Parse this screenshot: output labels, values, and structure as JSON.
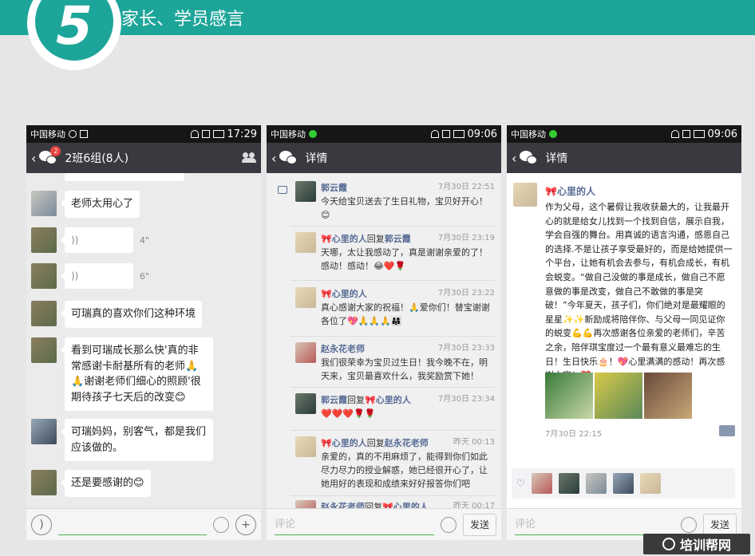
{
  "header": {
    "number": "5",
    "title": "家长、学员感言"
  },
  "phone1": {
    "status": {
      "carrier": "中国移动",
      "time": "17:29"
    },
    "title": "2班6组(8人)",
    "unread": "2",
    "messages": [
      {
        "text": "老师太用心了"
      },
      {
        "duration": "4\""
      },
      {
        "duration": "6\""
      },
      {
        "text": "可瑞真的喜欢你们这种环境"
      },
      {
        "text": "看到可瑞成长那么快'真的非常感谢卡耐基所有的老师🙏🙏谢谢老师们细心的照顾'很期待孩子七天后的改变😊"
      },
      {
        "text": "可瑞妈妈，别客气，都是我们应该做的。"
      },
      {
        "text": "还是要感谢的😊"
      }
    ]
  },
  "phone2": {
    "status": {
      "carrier": "中国移动",
      "time": "09:06"
    },
    "title": "详情",
    "comments": [
      {
        "name": "郭云霞",
        "reply_to": "",
        "time": "7月30日 22:51",
        "text": "今天给宝贝送去了生日礼物，宝贝好开心！😊"
      },
      {
        "name": "🎀心里的人",
        "reply_word": "回复",
        "reply_to": "郭云霞",
        "time": "7月30日 23:19",
        "text": "天哪，太让我感动了，真是谢谢亲爱的了！感动！感动！😂❤️🌹"
      },
      {
        "name": "🎀心里的人",
        "reply_to": "",
        "time": "7月30日 23:22",
        "text": "真心感谢大家的祝福！🙏爱你们！替宝谢谢各位了💖🙏🙏🙏👨‍👩‍👧"
      },
      {
        "name": "赵永花老师",
        "reply_to": "",
        "time": "7月30日 23:33",
        "text": "我们很荣幸为宝贝过生日！我今晚不在，明天来，宝贝最喜欢什么，我奖励赏下她！"
      },
      {
        "name": "郭云霞",
        "reply_word": "回复",
        "reply_to": "🎀心里的人",
        "time": "7月30日 23:34",
        "text": "❤️❤️❤️🌹🌹"
      },
      {
        "name": "🎀心里的人",
        "reply_word": "回复",
        "reply_to": "赵永花老师",
        "time": "昨天 00:13",
        "text": "亲爱的，真的不用麻烦了，能得到你们如此尽力尽力的授业解惑，她已经很开心了，让她用好的表现和成绩来好好报答你们吧"
      },
      {
        "name": "赵永花老师",
        "reply_word": "回复",
        "reply_to": "🎀心里的人",
        "time": "昨天 00:17",
        "text": ""
      }
    ],
    "input_placeholder": "评论",
    "send_label": "发送"
  },
  "phone3": {
    "status": {
      "carrier": "中国移动",
      "time": "09:06"
    },
    "title": "详情",
    "author": "🎀心里的人",
    "post_text": "作为父母，这个暑假让我收获最大的，让我最开心的就是给女儿找到一个找到自信，展示自我，学会自强的舞台。用真诚的语言沟通，感恩自己的选择.不是让孩子享受最好的，而是给她提供一个平台，让她有机会去参与，有机会成长，有机会蜕变。“做自己没做的事是成长，做自己不愿意做的事是改变，做自己不敢做的事是突破！”今年夏天，孩子们，你们绝对是最耀眼的星星✨✨新励成将陪伴你、与父母一同见证你的蜕变💪💪再次感谢各位亲爱的老师们，辛苦之余，陪伴琪宝度过一个最有意义最难忘的生日！生日快乐🎂！💖心里满满的感动！再次感谢大家！❤️",
    "post_time": "7月30日 22:15",
    "input_placeholder": "评论",
    "send_label": "发送"
  },
  "footer": {
    "brand": "培训帮网"
  }
}
